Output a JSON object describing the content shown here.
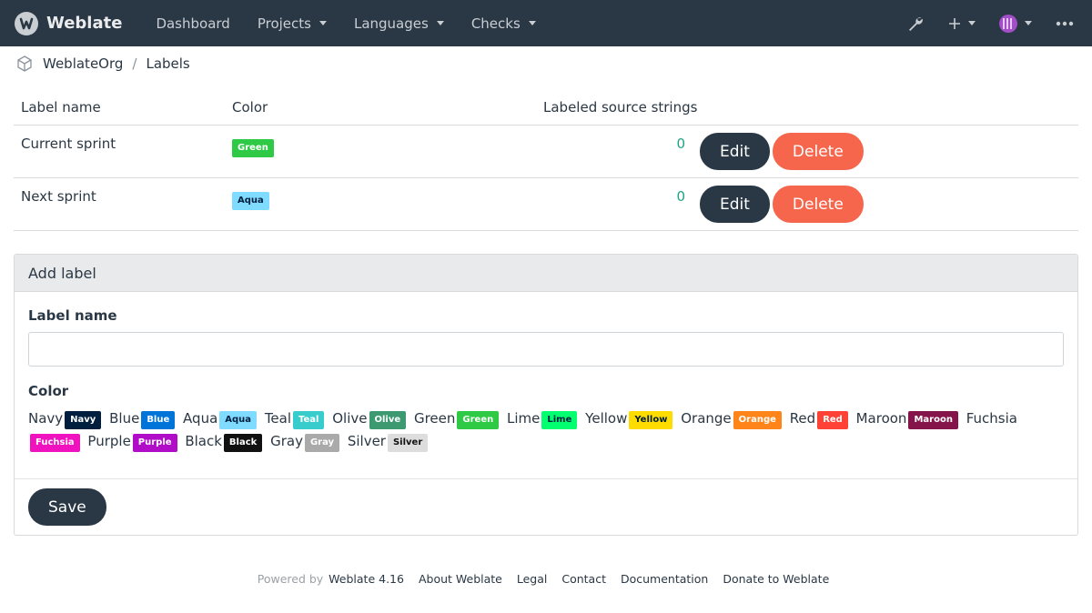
{
  "navbar": {
    "brand": "Weblate",
    "items": [
      {
        "label": "Dashboard",
        "dropdown": false
      },
      {
        "label": "Projects",
        "dropdown": true
      },
      {
        "label": "Languages",
        "dropdown": true
      },
      {
        "label": "Checks",
        "dropdown": true
      }
    ],
    "right_icons": [
      "wrench-icon",
      "plus-icon",
      "avatar",
      "more-icon"
    ]
  },
  "breadcrumb": {
    "items": [
      "WeblateOrg",
      "Labels"
    ],
    "separator": "/"
  },
  "table": {
    "headers": [
      "Label name",
      "Color",
      "Labeled source strings"
    ],
    "rows": [
      {
        "name": "Current sprint",
        "color": "Green",
        "color_hex": "#2eca45",
        "count": "0",
        "edit": "Edit",
        "delete": "Delete"
      },
      {
        "name": "Next sprint",
        "color": "Aqua",
        "color_hex": "#7fdbff",
        "count": "0",
        "edit": "Edit",
        "delete": "Delete"
      }
    ]
  },
  "add_label": {
    "title": "Add label",
    "name_label": "Label name",
    "name_value": "",
    "color_label": "Color",
    "colors": [
      {
        "name": "Navy",
        "badge": "Navy",
        "bg": "#001f3f",
        "fg": "#ffffff"
      },
      {
        "name": "Blue",
        "badge": "Blue",
        "bg": "#0074d9",
        "fg": "#ffffff"
      },
      {
        "name": "Aqua",
        "badge": "Aqua",
        "bg": "#7fdbff",
        "fg": "#001f3f"
      },
      {
        "name": "Teal",
        "badge": "Teal",
        "bg": "#39cccc",
        "fg": "#ffffff"
      },
      {
        "name": "Olive",
        "badge": "Olive",
        "bg": "#3d9970",
        "fg": "#ffffff"
      },
      {
        "name": "Green",
        "badge": "Green",
        "bg": "#2eca45",
        "fg": "#ffffff"
      },
      {
        "name": "Lime",
        "badge": "Lime",
        "bg": "#01ff70",
        "fg": "#001f3f"
      },
      {
        "name": "Yellow",
        "badge": "Yellow",
        "bg": "#ffdc00",
        "fg": "#001f3f"
      },
      {
        "name": "Orange",
        "badge": "Orange",
        "bg": "#ff851b",
        "fg": "#ffffff"
      },
      {
        "name": "Red",
        "badge": "Red",
        "bg": "#ff4136",
        "fg": "#ffffff"
      },
      {
        "name": "Maroon",
        "badge": "Maroon",
        "bg": "#85144b",
        "fg": "#ffffff"
      },
      {
        "name": "Fuchsia",
        "badge": "Fuchsia",
        "bg": "#f012be",
        "fg": "#ffffff"
      },
      {
        "name": "Purple",
        "badge": "Purple",
        "bg": "#b10dc9",
        "fg": "#ffffff"
      },
      {
        "name": "Black",
        "badge": "Black",
        "bg": "#111111",
        "fg": "#ffffff"
      },
      {
        "name": "Gray",
        "badge": "Gray",
        "bg": "#aaaaaa",
        "fg": "#ffffff"
      },
      {
        "name": "Silver",
        "badge": "Silver",
        "bg": "#dddddd",
        "fg": "#111111"
      }
    ],
    "save": "Save"
  },
  "footer": {
    "powered_by": "Powered by",
    "links": [
      "Weblate 4.16",
      "About Weblate",
      "Legal",
      "Contact",
      "Documentation",
      "Donate to Weblate"
    ]
  },
  "colors": {
    "navbar_bg": "#2a3744",
    "count_text": "#1fa385",
    "delete_button": "#f6664c",
    "edit_button": "#2a3744"
  }
}
